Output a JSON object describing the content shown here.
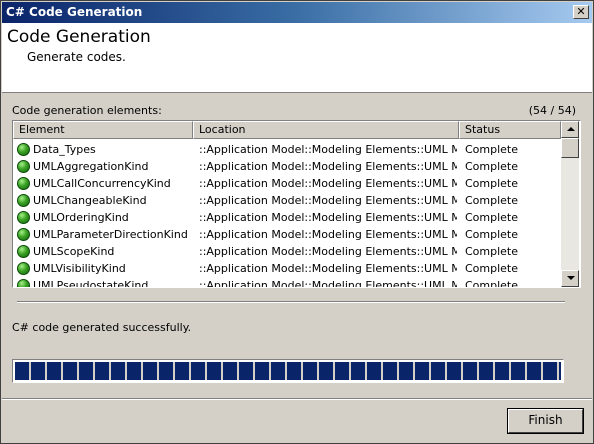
{
  "window": {
    "title": "C# Code Generation",
    "close_glyph": "✕"
  },
  "header": {
    "title": "Code Generation",
    "subtitle": "Generate codes."
  },
  "elements": {
    "label": "Code generation elements:",
    "count": "(54 / 54)",
    "columns": [
      "Element",
      "Location",
      "Status"
    ],
    "rows": [
      {
        "name": "Data_Types",
        "location": "::Application Model::Modeling Elements::UML Mod...",
        "status": "Complete"
      },
      {
        "name": "UMLAggregationKind",
        "location": "::Application Model::Modeling Elements::UML Mod...",
        "status": "Complete"
      },
      {
        "name": "UMLCallConcurrencyKind",
        "location": "::Application Model::Modeling Elements::UML Mod...",
        "status": "Complete"
      },
      {
        "name": "UMLChangeableKind",
        "location": "::Application Model::Modeling Elements::UML Mod...",
        "status": "Complete"
      },
      {
        "name": "UMLOrderingKind",
        "location": "::Application Model::Modeling Elements::UML Mod...",
        "status": "Complete"
      },
      {
        "name": "UMLParameterDirectionKind",
        "location": "::Application Model::Modeling Elements::UML Mod...",
        "status": "Complete"
      },
      {
        "name": "UMLScopeKind",
        "location": "::Application Model::Modeling Elements::UML Mod...",
        "status": "Complete"
      },
      {
        "name": "UMLVisibilityKind",
        "location": "::Application Model::Modeling Elements::UML Mod...",
        "status": "Complete"
      },
      {
        "name": "UMLPseudostateKind",
        "location": "::Application Model::Modeling Elements::UML Mod...",
        "status": "Complete"
      }
    ],
    "row_icon": "green-ok-icon"
  },
  "status_message": "C# code generated successfully.",
  "progress": {
    "fraction": 1.0,
    "color": "#0a246a"
  },
  "buttons": {
    "finish_label": "Finish"
  }
}
